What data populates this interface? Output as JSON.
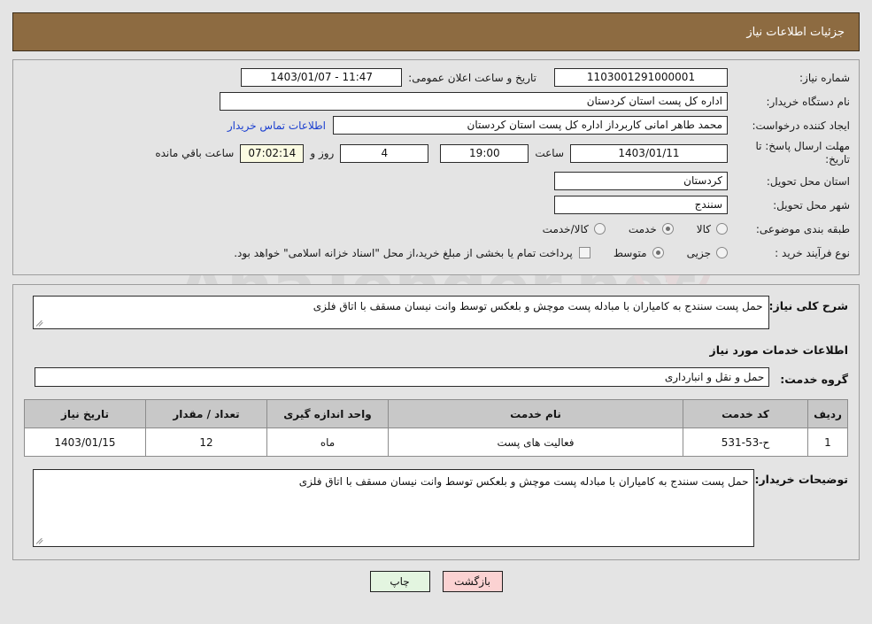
{
  "header": {
    "title": "جزئیات اطلاعات نیاز"
  },
  "watermark": {
    "text": "AnaTender.net"
  },
  "info": {
    "need_number_label": "شماره نیاز:",
    "need_number_value": "1103001291000001",
    "announce_label": "تاریخ و ساعت اعلان عمومی:",
    "announce_value": "11:47 - 1403/01/07",
    "buyer_org_label": "نام دستگاه خریدار:",
    "buyer_org_value": "اداره کل پست استان کردستان",
    "creator_label": "ایجاد کننده درخواست:",
    "creator_value": "محمد طاهر امانی کاربرداز اداره کل پست استان کردستان",
    "contact_link": "اطلاعات تماس خریدار",
    "deadline_label": "مهلت ارسال پاسخ: تا تاریخ:",
    "deadline_value": "1403/01/11",
    "hour_label": "ساعت",
    "hour_value": "19:00",
    "days_value": "4",
    "days_label": "روز و",
    "countdown_value": "07:02:14",
    "countdown_label": "ساعت باقي مانده",
    "province_label": "استان محل تحویل:",
    "province_value": "کردستان",
    "city_label": "شهر محل تحویل:",
    "city_value": "سنندج",
    "category_label": "طبقه بندی موضوعی:",
    "category_options": [
      {
        "label": "کالا",
        "selected": false
      },
      {
        "label": "خدمت",
        "selected": true
      },
      {
        "label": "کالا/خدمت",
        "selected": false
      }
    ],
    "process_label": "نوع فرآیند خرید :",
    "process_options": [
      {
        "label": "جزیی",
        "selected": false
      },
      {
        "label": "متوسط",
        "selected": true
      }
    ],
    "treasury_note": "پرداخت تمام یا بخشی از مبلغ خرید،از محل \"اسناد خزانه اسلامی\" خواهد بود.",
    "treasury_checked": false
  },
  "body": {
    "desc_label": "شرح کلی نیاز:",
    "desc_value": "حمل پست سنندج به کامیاران با مبادله پست موچش  و بلعکس توسط وانت نیسان مسقف با اتاق فلزی",
    "section_title": "اطلاعات خدمات مورد نیاز",
    "service_group_label": "گروه خدمت:",
    "service_group_value": "حمل و نقل و انبارداری",
    "notes_label": "توضیحات خریدار:",
    "notes_value": "حمل پست سنندج به کامیاران با مبادله پست موچش  و بلعکس توسط وانت نیسان مسقف با اتاق فلزی"
  },
  "table": {
    "columns": [
      "ردیف",
      "کد خدمت",
      "نام خدمت",
      "واحد اندازه گیری",
      "تعداد / مقدار",
      "تاریخ نیاز"
    ],
    "rows": [
      {
        "radif": "1",
        "code": "ح-53-531",
        "name": "فعالیت های پست",
        "unit": "ماه",
        "qty": "12",
        "date": "1403/01/15"
      }
    ]
  },
  "footer": {
    "print_label": "چاپ",
    "back_label": "بازگشت"
  },
  "colors": {
    "header_bg": "#8d6b41",
    "page_bg": "#e4e4e4",
    "link": "#1b3fd0",
    "countdown_bg": "#fbfbe2",
    "back_btn_bg": "#fbd2d2",
    "print_btn_bg": "#e3f5e0"
  }
}
